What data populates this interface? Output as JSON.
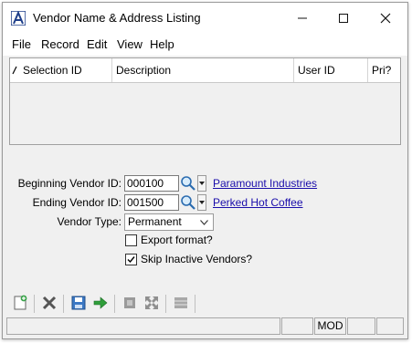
{
  "window": {
    "title": "Vendor Name & Address Listing"
  },
  "menu": [
    "File",
    "Record",
    "Edit",
    "View",
    "Help"
  ],
  "grid": {
    "columns": [
      "Selection ID",
      "Description",
      "User ID",
      "Pri?"
    ]
  },
  "form": {
    "beginning_label": "Beginning Vendor ID:",
    "beginning_value": "000100",
    "beginning_name": "Paramount Industries",
    "ending_label": "Ending Vendor ID:",
    "ending_value": "001500",
    "ending_name": "Perked Hot Coffee",
    "type_label": "Vendor Type:",
    "type_value": "Permanent",
    "export_label": "Export format?",
    "export_checked": false,
    "skip_label": "Skip Inactive Vendors?",
    "skip_checked": true
  },
  "status": {
    "mode": "MOD"
  }
}
